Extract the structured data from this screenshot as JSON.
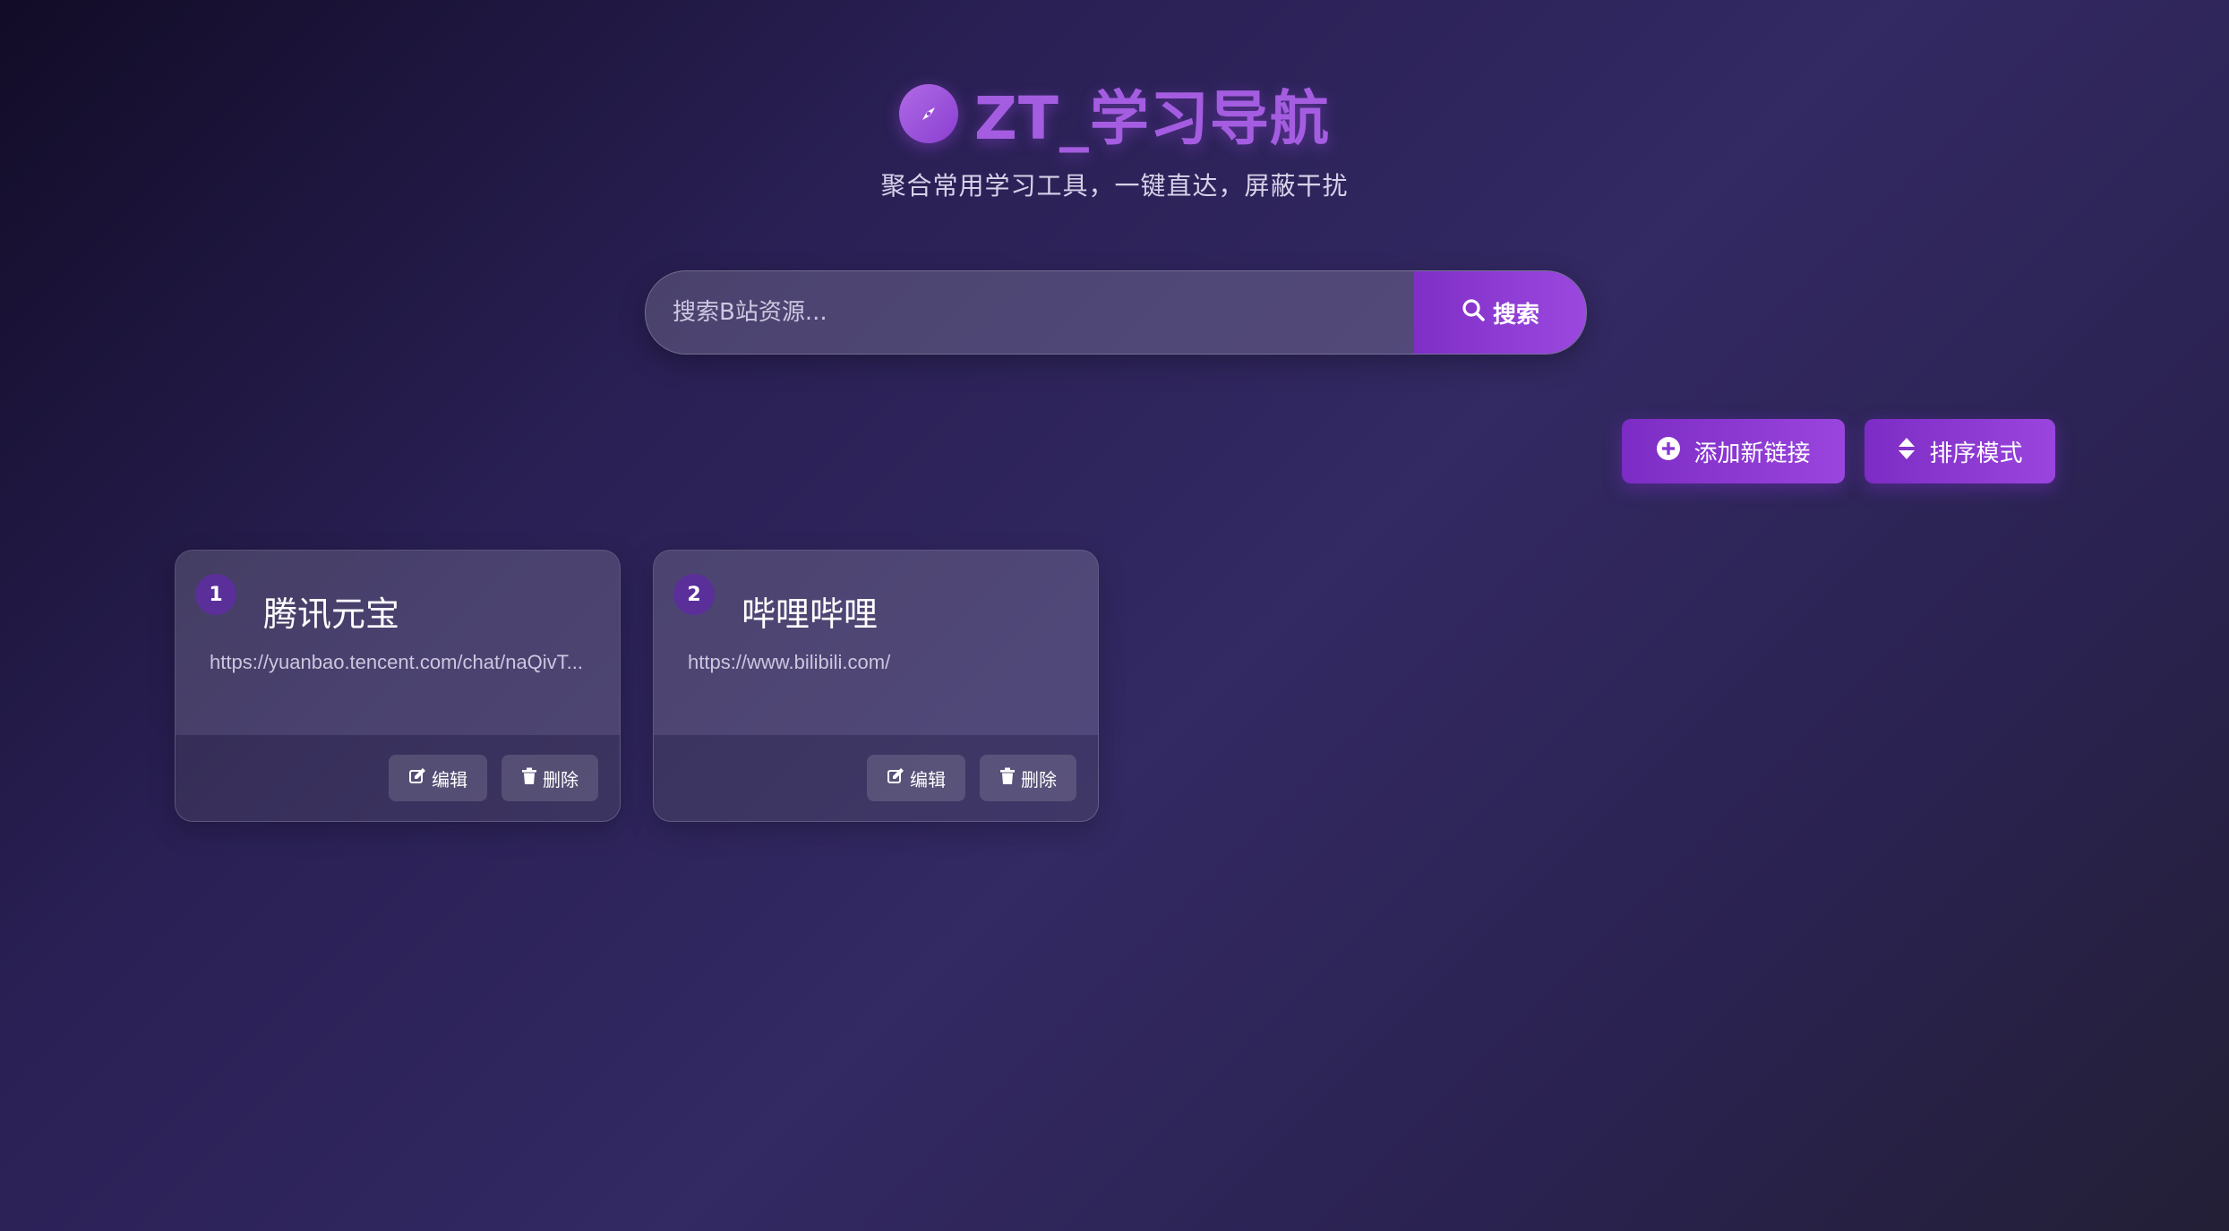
{
  "header": {
    "title": "ZT_学习导航",
    "subtitle": "聚合常用学习工具，一键直达，屏蔽干扰",
    "logo_icon": "compass-icon"
  },
  "search": {
    "placeholder": "搜索B站资源...",
    "value": "",
    "button_label": "搜索",
    "button_icon": "search-icon"
  },
  "actions": {
    "add_label": "添加新链接",
    "add_icon": "plus-circle-icon",
    "sort_label": "排序模式",
    "sort_icon": "sort-icon"
  },
  "cards": [
    {
      "index": "1",
      "title": "腾讯元宝",
      "url": "https://yuanbao.tencent.com/chat/naQivT...",
      "edit_label": "编辑",
      "delete_label": "删除"
    },
    {
      "index": "2",
      "title": "哔哩哔哩",
      "url": "https://www.bilibili.com/",
      "edit_label": "编辑",
      "delete_label": "删除"
    }
  ],
  "colors": {
    "accent": "#9b48df",
    "title": "#a45de0",
    "background_dark": "#120c27",
    "background_mid": "#332963"
  }
}
